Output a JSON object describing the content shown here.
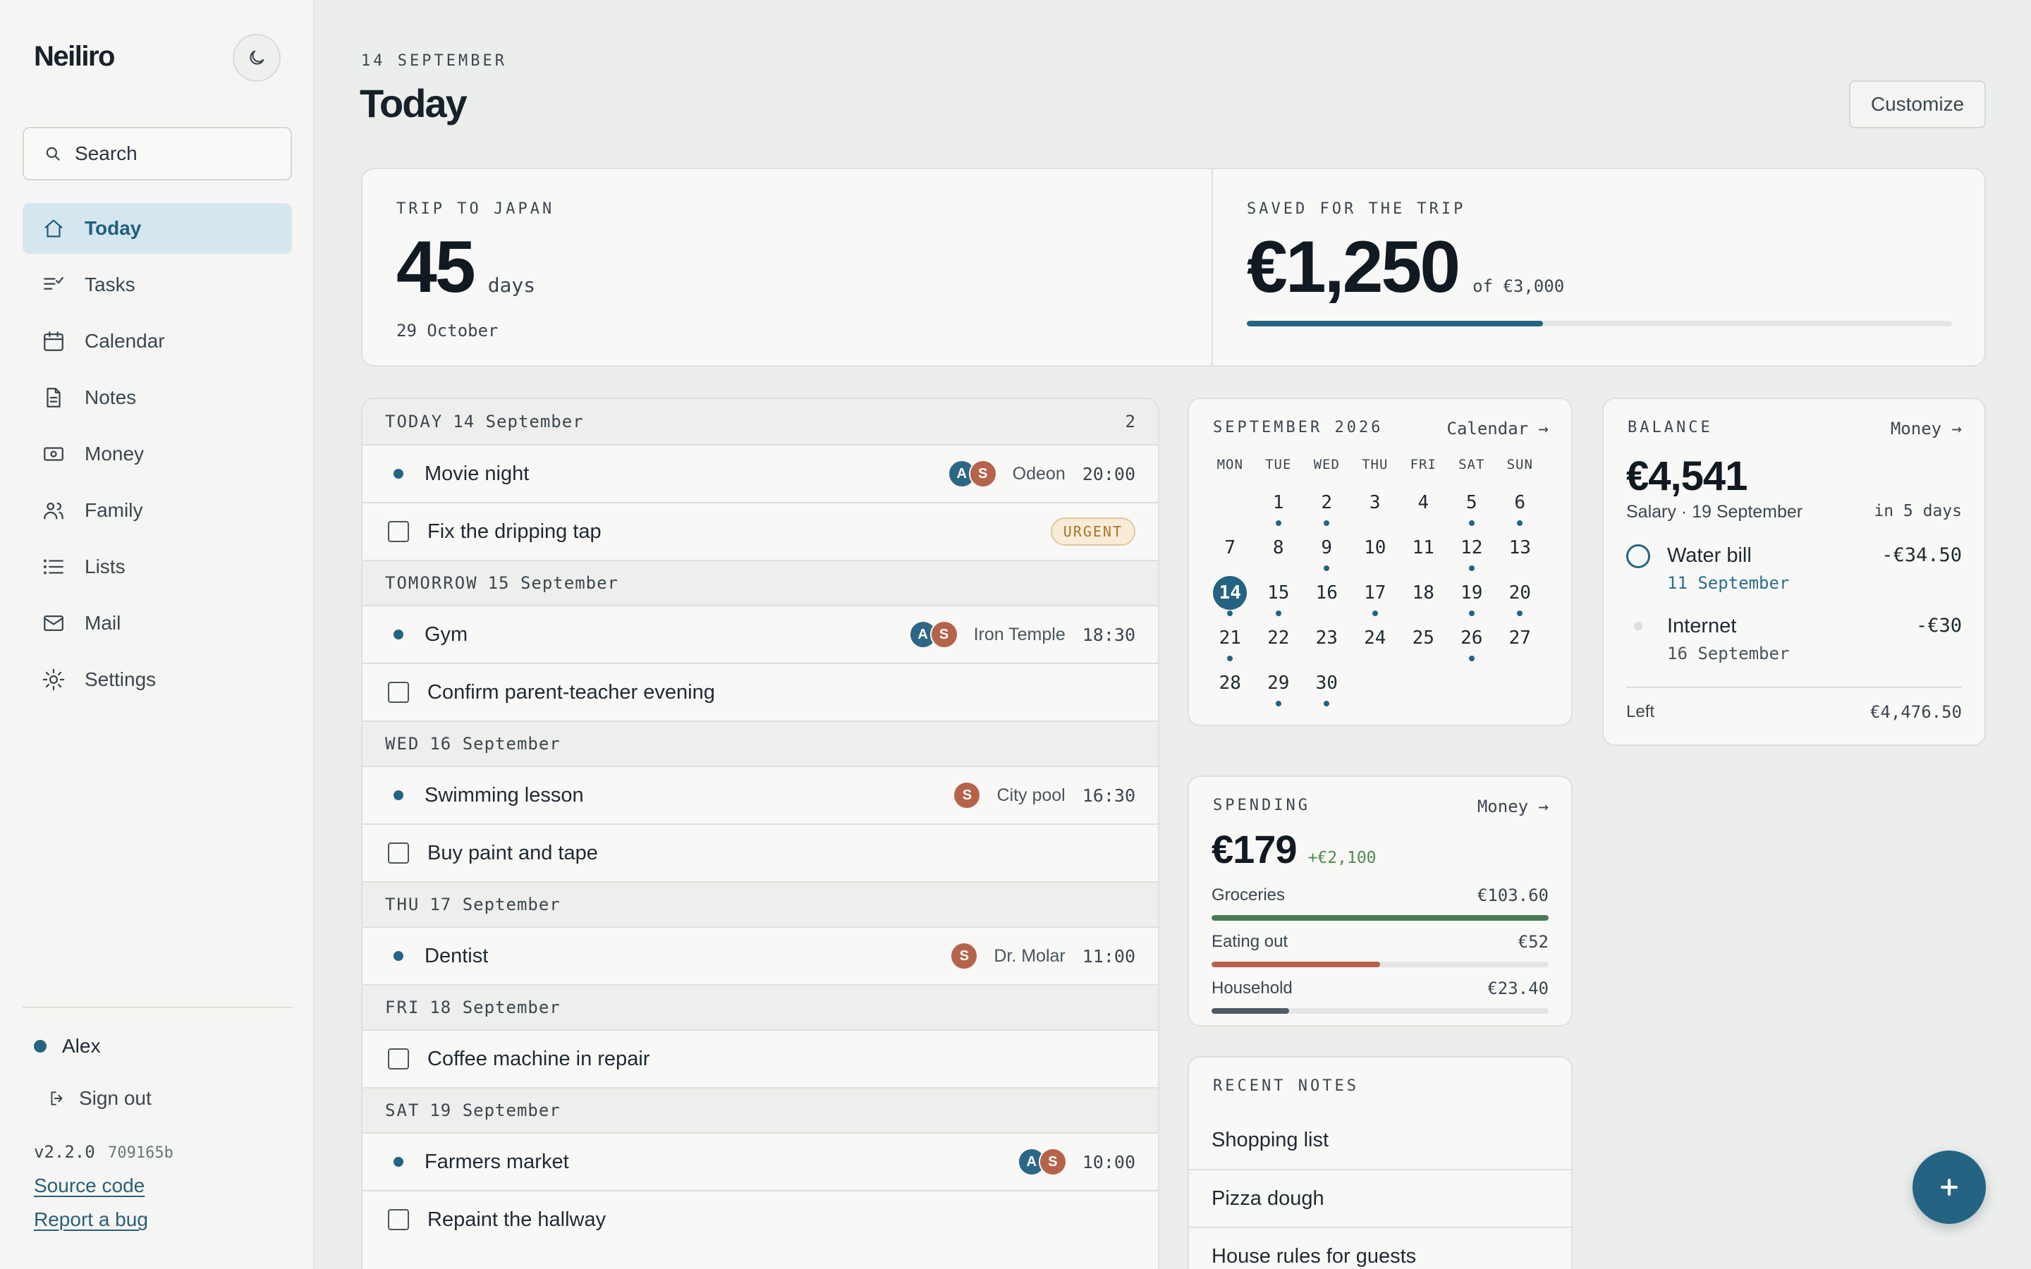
{
  "app": {
    "name": "Neiliro"
  },
  "search": {
    "placeholder": "Search"
  },
  "nav": [
    {
      "label": "Today",
      "icon": "home-icon",
      "active": true
    },
    {
      "label": "Tasks",
      "icon": "tasks-icon"
    },
    {
      "label": "Calendar",
      "icon": "calendar-icon"
    },
    {
      "label": "Notes",
      "icon": "document-icon"
    },
    {
      "label": "Money",
      "icon": "money-icon"
    },
    {
      "label": "Family",
      "icon": "family-icon"
    },
    {
      "label": "Lists",
      "icon": "list-icon"
    },
    {
      "label": "Mail",
      "icon": "mail-icon"
    },
    {
      "label": "Settings",
      "icon": "gear-icon"
    }
  ],
  "user": {
    "name": "Alex",
    "sign_out": "Sign out"
  },
  "footer": {
    "version": "v2.2.0",
    "hash": "709165b",
    "source": "Source code",
    "bug": "Report a bug"
  },
  "header": {
    "date": "14 SEPTEMBER",
    "title": "Today",
    "customize": "Customize"
  },
  "countdown": {
    "label": "TRIP TO JAPAN",
    "value": "45",
    "unit": "days",
    "date": "29 October"
  },
  "savings": {
    "label": "SAVED FOR THE TRIP",
    "amount": "€1,250",
    "of": "of €3,000",
    "progress": 0.42
  },
  "agenda": {
    "groups": [
      {
        "day": "TODAY",
        "date": "14 September",
        "count": "2",
        "items": [
          {
            "type": "event",
            "title": "Movie night",
            "avatars": [
              "A",
              "S"
            ],
            "location": "Odeon",
            "time": "20:00"
          },
          {
            "type": "task",
            "title": "Fix the dripping tap",
            "badge": "URGENT"
          }
        ]
      },
      {
        "day": "TOMORROW",
        "date": "15 September",
        "items": [
          {
            "type": "event",
            "title": "Gym",
            "avatars": [
              "A",
              "S"
            ],
            "location": "Iron Temple",
            "time": "18:30"
          },
          {
            "type": "task",
            "title": "Confirm parent-teacher evening"
          }
        ]
      },
      {
        "day": "WED",
        "date": "16 September",
        "items": [
          {
            "type": "event",
            "title": "Swimming lesson",
            "avatars": [
              "S"
            ],
            "location": "City pool",
            "time": "16:30"
          },
          {
            "type": "task",
            "title": "Buy paint and tape"
          }
        ]
      },
      {
        "day": "THU",
        "date": "17 September",
        "items": [
          {
            "type": "event",
            "title": "Dentist",
            "avatars": [
              "S"
            ],
            "location": "Dr. Molar",
            "time": "11:00"
          }
        ]
      },
      {
        "day": "FRI",
        "date": "18 September",
        "items": [
          {
            "type": "task",
            "title": "Coffee machine in repair"
          }
        ]
      },
      {
        "day": "SAT",
        "date": "19 September",
        "items": [
          {
            "type": "event",
            "title": "Farmers market",
            "avatars": [
              "A",
              "S"
            ],
            "location": "",
            "time": "10:00"
          },
          {
            "type": "task",
            "title": "Repaint the hallway"
          }
        ]
      }
    ]
  },
  "calendar": {
    "title": "SEPTEMBER 2026",
    "link": "Calendar →",
    "weekdays": [
      "MON",
      "TUE",
      "WED",
      "THU",
      "FRI",
      "SAT",
      "SUN"
    ],
    "leading_blanks": 1,
    "days_in_month": 30,
    "today": 14,
    "event_days": [
      1,
      2,
      5,
      6,
      9,
      12,
      14,
      15,
      17,
      19,
      20,
      21,
      26,
      29,
      30
    ]
  },
  "balance": {
    "label": "BALANCE",
    "link": "Money →",
    "amount": "€4,541",
    "next": "Salary · 19 September",
    "next_in": "in 5 days",
    "bills": [
      {
        "name": "Water bill",
        "date": "11 September",
        "amount": "-€34.50",
        "status": "due"
      },
      {
        "name": "Internet",
        "date": "16 September",
        "amount": "-€30",
        "status": "upcoming"
      }
    ],
    "left_label": "Left",
    "left_value": "€4,476.50"
  },
  "spending": {
    "label": "SPENDING",
    "link": "Money →",
    "amount": "€179",
    "income": "+€2,100",
    "categories": [
      {
        "name": "Groceries",
        "value": "€103.60",
        "fraction": 1.0,
        "color": "#4b7a55"
      },
      {
        "name": "Eating out",
        "value": "€52",
        "fraction": 0.5,
        "color": "#b5634a"
      },
      {
        "name": "Household",
        "value": "€23.40",
        "fraction": 0.23,
        "color": "#4e5a64"
      }
    ]
  },
  "notes": {
    "label": "RECENT NOTES",
    "items": [
      "Shopping list",
      "Pizza dough",
      "House rules for guests"
    ]
  },
  "colors": {
    "accent": "#246482",
    "avatar_a": "#2c6785",
    "avatar_s": "#b5634a"
  }
}
